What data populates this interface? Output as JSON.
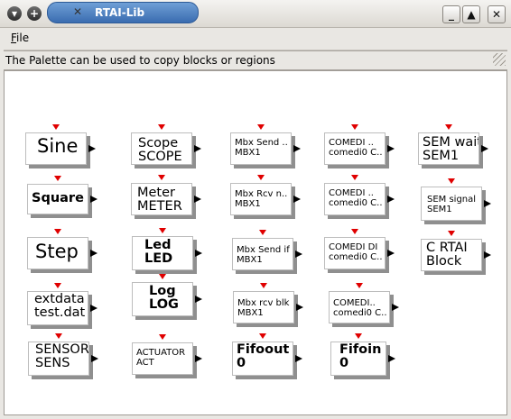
{
  "window": {
    "title": "RTAI-Lib"
  },
  "titlebar": {
    "menu_button": "▾",
    "add_button": "+",
    "minimize": "_",
    "maximize": "▲",
    "close": "✕"
  },
  "menu": {
    "file": "File",
    "file_mnemonic": "F",
    "file_rest": "ile"
  },
  "status": {
    "text": "The Palette can be used to copy blocks or regions"
  },
  "blocks": {
    "sine": [
      "Sine"
    ],
    "square": [
      "Square"
    ],
    "step": [
      "Step"
    ],
    "extdata": [
      "extdata",
      "test.dat"
    ],
    "sensor": [
      "SENSOR",
      "SENS"
    ],
    "scope": [
      "Scope",
      "SCOPE"
    ],
    "meter": [
      "Meter",
      "METER"
    ],
    "led": [
      "Led",
      "LED"
    ],
    "log": [
      "Log",
      "LOG"
    ],
    "actuator": [
      "ACTUATOR",
      "ACT"
    ],
    "mbx_send": [
      "Mbx Send ..",
      "MBX1"
    ],
    "mbx_rcv": [
      "Mbx Rcv n..",
      "MBX1"
    ],
    "mbx_send_if": [
      "Mbx Send if",
      "MBX1"
    ],
    "mbx_rcv_blk": [
      "Mbx rcv blk",
      "MBX1"
    ],
    "fifoout": [
      "Fifoout",
      "0"
    ],
    "comedi1": [
      "COMEDI ..",
      "comedi0 C.."
    ],
    "comedi2": [
      "COMEDI ..",
      "comedi0 C.."
    ],
    "comedi_di": [
      "COMEDI DI",
      "comedi0 C.."
    ],
    "comedi4": [
      "COMEDI..",
      "comedi0 C.."
    ],
    "fifoin": [
      "Fifoin",
      "0"
    ],
    "sem_wait": [
      "SEM wait",
      "SEM1"
    ],
    "sem_signal": [
      "SEM signal",
      "SEM1"
    ],
    "c_rtai": [
      "C RTAI",
      "Block"
    ]
  }
}
